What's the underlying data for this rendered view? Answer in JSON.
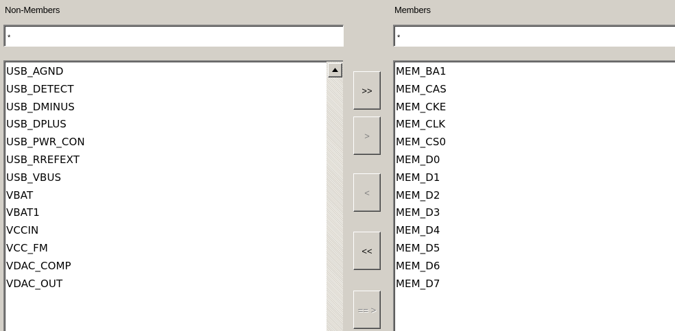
{
  "non_members": {
    "label": "Non-Members",
    "filter_value": "*",
    "items": [
      "USB_AGND",
      "USB_DETECT",
      "USB_DMINUS",
      "USB_DPLUS",
      "USB_PWR_CON",
      "USB_RREFEXT",
      "USB_VBUS",
      "VBAT",
      "VBAT1",
      "VCCIN",
      "VCC_FM",
      "VDAC_COMP",
      "VDAC_OUT"
    ]
  },
  "members": {
    "label": "Members",
    "filter_value": "*",
    "items": [
      "MEM_BA1",
      "MEM_CAS",
      "MEM_CKE",
      "MEM_CLK",
      "MEM_CS0",
      "MEM_D0",
      "MEM_D1",
      "MEM_D2",
      "MEM_D3",
      "MEM_D4",
      "MEM_D5",
      "MEM_D6",
      "MEM_D7"
    ]
  },
  "buttons": {
    "add_all": ">>",
    "add_selected": ">",
    "remove_selected": "<",
    "remove_all": "<<",
    "add_matching": "== >"
  },
  "icons": {
    "scroll_up": "triangle-up-icon"
  }
}
